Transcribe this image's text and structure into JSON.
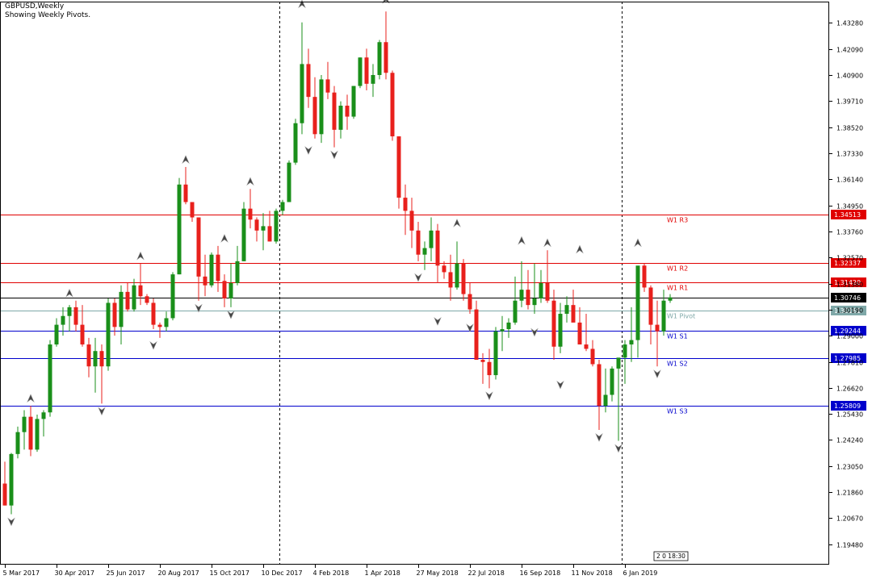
{
  "header": {
    "title": "GBPUSD,Weekly",
    "subtitle": "Showing Weekly Pivots."
  },
  "colors": {
    "bull": "#1a8f1a",
    "bear": "#e8201c",
    "resistance": "#e00000",
    "support": "#0000cc",
    "pivot": "#7fa8a8",
    "current": "#000000"
  },
  "icons": {
    "fractal_up": "arrow-up-icon",
    "fractal_down": "arrow-down-icon"
  },
  "timer_label": "2 0 18:30",
  "chart_data": {
    "type": "candlestick",
    "title": "GBPUSD,Weekly",
    "subtitle": "Showing Weekly Pivots.",
    "ylim": [
      1.1855,
      1.4425
    ],
    "y_ticks": [
      "1.43280",
      "1.42090",
      "1.40900",
      "1.39710",
      "1.38520",
      "1.37330",
      "1.36140",
      "1.34950",
      "1.33760",
      "1.32570",
      "1.31380",
      "1.30190",
      "1.29000",
      "1.27810",
      "1.26620",
      "1.25430",
      "1.24240",
      "1.23050",
      "1.21860",
      "1.20670",
      "1.19480"
    ],
    "x_ticks": [
      {
        "label": "5 Mar 2017",
        "index": 0
      },
      {
        "label": "30 Apr 2017",
        "index": 8
      },
      {
        "label": "25 Jun 2017",
        "index": 16
      },
      {
        "label": "20 Aug 2017",
        "index": 24
      },
      {
        "label": "15 Oct 2017",
        "index": 32
      },
      {
        "label": "10 Dec 2017",
        "index": 40
      },
      {
        "label": "4 Feb 2018",
        "index": 48
      },
      {
        "label": "1 Apr 2018",
        "index": 56
      },
      {
        "label": "27 May 2018",
        "index": 64
      },
      {
        "label": "22 Jul 2018",
        "index": 72
      },
      {
        "label": "16 Sep 2018",
        "index": 80
      },
      {
        "label": "11 Nov 2018",
        "index": 88
      },
      {
        "label": "6 Jan 2019",
        "index": 96
      }
    ],
    "candles": [
      [
        1.2225,
        1.2325,
        1.2125,
        1.2125
      ],
      [
        1.2125,
        1.2365,
        1.2085,
        1.236
      ],
      [
        1.236,
        1.2485,
        1.234,
        1.246
      ],
      [
        1.246,
        1.256,
        1.238,
        1.253
      ],
      [
        1.253,
        1.258,
        1.235,
        1.238
      ],
      [
        1.238,
        1.254,
        1.237,
        1.252
      ],
      [
        1.252,
        1.256,
        1.244,
        1.255
      ],
      [
        1.255,
        1.288,
        1.253,
        1.286
      ],
      [
        1.286,
        1.298,
        1.285,
        1.295
      ],
      [
        1.295,
        1.303,
        1.29,
        1.299
      ],
      [
        1.299,
        1.304,
        1.292,
        1.303
      ],
      [
        1.303,
        1.306,
        1.292,
        1.295
      ],
      [
        1.295,
        1.304,
        1.285,
        1.286
      ],
      [
        1.286,
        1.289,
        1.271,
        1.276
      ],
      [
        1.276,
        1.289,
        1.264,
        1.283
      ],
      [
        1.283,
        1.286,
        1.259,
        1.276
      ],
      [
        1.276,
        1.307,
        1.274,
        1.305
      ],
      [
        1.305,
        1.307,
        1.29,
        1.294
      ],
      [
        1.294,
        1.313,
        1.286,
        1.31
      ],
      [
        1.31,
        1.314,
        1.301,
        1.302
      ],
      [
        1.302,
        1.316,
        1.301,
        1.313
      ],
      [
        1.313,
        1.323,
        1.304,
        1.308
      ],
      [
        1.308,
        1.309,
        1.304,
        1.305
      ],
      [
        1.305,
        1.307,
        1.293,
        1.295
      ],
      [
        1.295,
        1.296,
        1.289,
        1.294
      ],
      [
        1.294,
        1.301,
        1.292,
        1.298
      ],
      [
        1.298,
        1.319,
        1.297,
        1.318
      ],
      [
        1.318,
        1.362,
        1.318,
        1.359
      ],
      [
        1.359,
        1.367,
        1.35,
        1.351
      ],
      [
        1.351,
        1.351,
        1.342,
        1.344
      ],
      [
        1.344,
        1.344,
        1.306,
        1.317
      ],
      [
        1.317,
        1.327,
        1.308,
        1.313
      ],
      [
        1.313,
        1.328,
        1.312,
        1.327
      ],
      [
        1.327,
        1.331,
        1.31,
        1.315
      ],
      [
        1.315,
        1.318,
        1.303,
        1.307
      ],
      [
        1.307,
        1.323,
        1.303,
        1.314
      ],
      [
        1.314,
        1.331,
        1.313,
        1.324
      ],
      [
        1.324,
        1.351,
        1.324,
        1.348
      ],
      [
        1.348,
        1.357,
        1.339,
        1.343
      ],
      [
        1.343,
        1.344,
        1.333,
        1.338
      ],
      [
        1.338,
        1.346,
        1.329,
        1.34
      ],
      [
        1.34,
        1.347,
        1.333,
        1.333
      ],
      [
        1.333,
        1.348,
        1.332,
        1.347
      ],
      [
        1.347,
        1.352,
        1.345,
        1.351
      ],
      [
        1.351,
        1.37,
        1.351,
        1.369
      ],
      [
        1.369,
        1.389,
        1.368,
        1.387
      ],
      [
        1.387,
        1.433,
        1.382,
        1.414
      ],
      [
        1.414,
        1.421,
        1.394,
        1.399
      ],
      [
        1.399,
        1.408,
        1.38,
        1.382
      ],
      [
        1.382,
        1.409,
        1.378,
        1.407
      ],
      [
        1.407,
        1.415,
        1.398,
        1.401
      ],
      [
        1.401,
        1.404,
        1.376,
        1.384
      ],
      [
        1.384,
        1.397,
        1.38,
        1.395
      ],
      [
        1.395,
        1.4,
        1.384,
        1.39
      ],
      [
        1.39,
        1.404,
        1.389,
        1.404
      ],
      [
        1.404,
        1.417,
        1.403,
        1.417
      ],
      [
        1.417,
        1.421,
        1.402,
        1.405
      ],
      [
        1.405,
        1.414,
        1.399,
        1.409
      ],
      [
        1.409,
        1.425,
        1.407,
        1.424
      ],
      [
        1.424,
        1.438,
        1.407,
        1.41
      ],
      [
        1.41,
        1.411,
        1.379,
        1.381
      ],
      [
        1.381,
        1.381,
        1.348,
        1.353
      ],
      [
        1.353,
        1.359,
        1.336,
        1.347
      ],
      [
        1.347,
        1.353,
        1.33,
        1.338
      ],
      [
        1.338,
        1.342,
        1.324,
        1.327
      ],
      [
        1.327,
        1.333,
        1.32,
        1.33
      ],
      [
        1.33,
        1.344,
        1.324,
        1.338
      ],
      [
        1.338,
        1.341,
        1.314,
        1.322
      ],
      [
        1.322,
        1.324,
        1.316,
        1.319
      ],
      [
        1.319,
        1.327,
        1.306,
        1.312
      ],
      [
        1.312,
        1.333,
        1.311,
        1.323
      ],
      [
        1.323,
        1.325,
        1.306,
        1.309
      ],
      [
        1.309,
        1.314,
        1.3,
        1.302
      ],
      [
        1.302,
        1.306,
        1.279,
        1.279
      ],
      [
        1.279,
        1.282,
        1.268,
        1.278
      ],
      [
        1.278,
        1.284,
        1.266,
        1.272
      ],
      [
        1.272,
        1.294,
        1.27,
        1.292
      ],
      [
        1.292,
        1.299,
        1.283,
        1.293
      ],
      [
        1.293,
        1.298,
        1.289,
        1.296
      ],
      [
        1.296,
        1.317,
        1.295,
        1.306
      ],
      [
        1.306,
        1.324,
        1.303,
        1.311
      ],
      [
        1.311,
        1.32,
        1.302,
        1.304
      ],
      [
        1.304,
        1.323,
        1.3,
        1.307
      ],
      [
        1.307,
        1.32,
        1.305,
        1.314
      ],
      [
        1.314,
        1.329,
        1.305,
        1.306
      ],
      [
        1.306,
        1.311,
        1.279,
        1.285
      ],
      [
        1.285,
        1.305,
        1.282,
        1.3
      ],
      [
        1.3,
        1.308,
        1.296,
        1.304
      ],
      [
        1.304,
        1.311,
        1.297,
        1.296
      ],
      [
        1.296,
        1.303,
        1.288,
        1.286
      ],
      [
        1.286,
        1.3,
        1.283,
        1.284
      ],
      [
        1.284,
        1.288,
        1.276,
        1.277
      ],
      [
        1.277,
        1.279,
        1.247,
        1.258
      ],
      [
        1.258,
        1.275,
        1.255,
        1.263
      ],
      [
        1.263,
        1.276,
        1.26,
        1.275
      ],
      [
        1.275,
        1.277,
        1.242,
        1.28
      ],
      [
        1.28,
        1.288,
        1.268,
        1.286
      ],
      [
        1.286,
        1.303,
        1.278,
        1.288
      ],
      [
        1.288,
        1.314,
        1.28,
        1.322
      ],
      [
        1.322,
        1.323,
        1.31,
        1.312
      ],
      [
        1.312,
        1.313,
        1.286,
        1.295
      ],
      [
        1.295,
        1.306,
        1.276,
        1.292
      ],
      [
        1.292,
        1.311,
        1.29,
        1.306
      ],
      [
        1.306,
        1.309,
        1.305,
        1.3075
      ]
    ],
    "fractals": [
      {
        "index": 1,
        "dir": "down",
        "price": 1.2085
      },
      {
        "index": 4,
        "dir": "up",
        "price": 1.258
      },
      {
        "index": 10,
        "dir": "up",
        "price": 1.306
      },
      {
        "index": 15,
        "dir": "down",
        "price": 1.259
      },
      {
        "index": 21,
        "dir": "up",
        "price": 1.323
      },
      {
        "index": 23,
        "dir": "down",
        "price": 1.289
      },
      {
        "index": 28,
        "dir": "up",
        "price": 1.367
      },
      {
        "index": 30,
        "dir": "down",
        "price": 1.306
      },
      {
        "index": 34,
        "dir": "up",
        "price": 1.331
      },
      {
        "index": 35,
        "dir": "down",
        "price": 1.303
      },
      {
        "index": 38,
        "dir": "up",
        "price": 1.357
      },
      {
        "index": 46,
        "dir": "up",
        "price": 1.438
      },
      {
        "index": 47,
        "dir": "down",
        "price": 1.378
      },
      {
        "index": 51,
        "dir": "down",
        "price": 1.376
      },
      {
        "index": 59,
        "dir": "up",
        "price": 1.44
      },
      {
        "index": 64,
        "dir": "down",
        "price": 1.32
      },
      {
        "index": 67,
        "dir": "down",
        "price": 1.3
      },
      {
        "index": 70,
        "dir": "up",
        "price": 1.338
      },
      {
        "index": 72,
        "dir": "down",
        "price": 1.297
      },
      {
        "index": 75,
        "dir": "down",
        "price": 1.266
      },
      {
        "index": 80,
        "dir": "up",
        "price": 1.33
      },
      {
        "index": 82,
        "dir": "down",
        "price": 1.295
      },
      {
        "index": 84,
        "dir": "up",
        "price": 1.329
      },
      {
        "index": 86,
        "dir": "down",
        "price": 1.271
      },
      {
        "index": 89,
        "dir": "up",
        "price": 1.326
      },
      {
        "index": 92,
        "dir": "down",
        "price": 1.247
      },
      {
        "index": 95,
        "dir": "down",
        "price": 1.242
      },
      {
        "index": 98,
        "dir": "up",
        "price": 1.329
      },
      {
        "index": 101,
        "dir": "down",
        "price": 1.276
      }
    ],
    "pivot_lines": [
      {
        "name": "W1 R3",
        "value": 1.34513,
        "label": "1.34513",
        "kind": "resistance"
      },
      {
        "name": "W1 R2",
        "value": 1.32337,
        "label": "1.32337",
        "kind": "resistance"
      },
      {
        "name": "W1 R1",
        "value": 1.3142,
        "label": "1.31420",
        "kind": "resistance"
      },
      {
        "name": "W1 Pivot",
        "value": 1.30161,
        "label": "1.30161",
        "kind": "pivot"
      },
      {
        "name": "W1 S1",
        "value": 1.29244,
        "label": "1.29244",
        "kind": "support"
      },
      {
        "name": "W1 S2",
        "value": 1.27985,
        "label": "1.27985",
        "kind": "support"
      },
      {
        "name": "W1 S3",
        "value": 1.25809,
        "label": "1.25809",
        "kind": "support"
      }
    ],
    "current_price": {
      "value": 1.30746,
      "label": "1.30746"
    },
    "period_separators": [
      42,
      95
    ],
    "grid": false,
    "legend": "none"
  }
}
